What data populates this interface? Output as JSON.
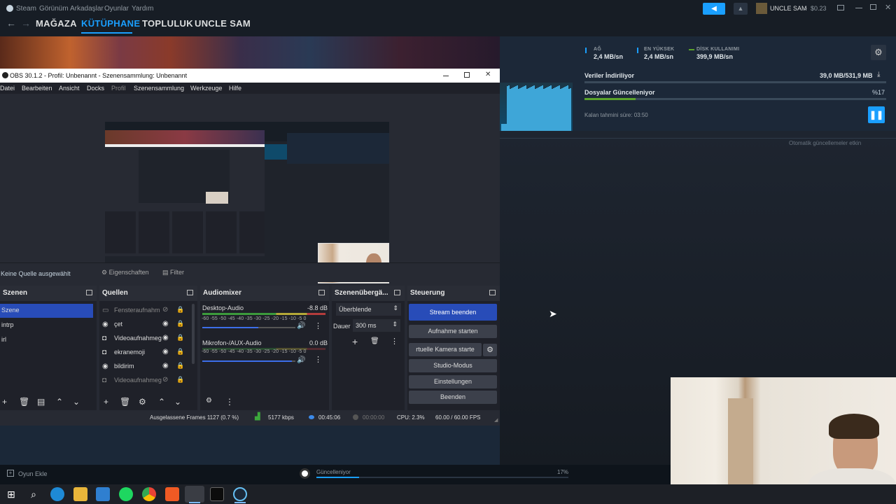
{
  "steam": {
    "menu": [
      "Steam",
      "Görünüm",
      "Arkadaşlar",
      "Oyunlar",
      "Yardım"
    ],
    "nav": [
      "MAĞAZA",
      "KÜTÜPHANE",
      "TOPLULUK",
      "UNCLE SAM"
    ],
    "user": {
      "name": "UNCLE SAM",
      "balance": "$0.23"
    },
    "stats": [
      {
        "label": "AĞ",
        "value": "2,4 MB/sn",
        "color": "#1a9fff"
      },
      {
        "label": "EN YÜKSEK",
        "value": "2,4 MB/sn",
        "color": "#1a9fff"
      },
      {
        "label": "DİSK KULLANIMI",
        "value": "399,9 MB/sn",
        "color": "#5ba32b"
      }
    ],
    "download": {
      "row1_label": "Veriler İndiriliyor",
      "row1_value": "39,0 MB/531,9 MB",
      "row2_label": "Dosyalar Güncelleniyor",
      "row2_value": "%17",
      "progress": 0.17,
      "eta": "Kalan tahmini süre: 03:50",
      "auto_updates": "Otomatik güncellemeler etkin"
    },
    "bottom": {
      "add_game": "Oyun Ekle",
      "status": "Güncelleniyor",
      "percent": "17%"
    }
  },
  "obs": {
    "title": "OBS 30.1.2 - Profil: Unbenannt - Szenensammlung: Unbenannt",
    "menu": [
      "Datei",
      "Bearbeiten",
      "Ansicht",
      "Docks",
      "Profil",
      "Szenensammlung",
      "Werkzeuge",
      "Hilfe"
    ],
    "no_source": "Keine Quelle ausgewählt",
    "properties": "Eigenschaften",
    "filter": "Filter",
    "docks": {
      "scenes": "Szenen",
      "sources": "Quellen",
      "mixer": "Audiomixer",
      "transitions": "Szenenübergä...",
      "controls": "Steuerung"
    },
    "scenes": [
      "Szene",
      "intrp",
      "irl"
    ],
    "sources": [
      {
        "name": "Fensteraufnahm",
        "icon": "window-icon"
      },
      {
        "name": "çet",
        "icon": "browser-icon"
      },
      {
        "name": "Videoaufnahmeg",
        "icon": "camera-icon"
      },
      {
        "name": "ekranemoji",
        "icon": "camera-icon"
      },
      {
        "name": "bildirim",
        "icon": "browser-icon"
      },
      {
        "name": "Videoaufnahmeg",
        "icon": "camera-icon"
      }
    ],
    "audio": [
      {
        "name": "Desktop-Audio",
        "db": "-8.8 dB",
        "level": 0.6
      },
      {
        "name": "Mikrofon-/AUX-Audio",
        "db": "0.0 dB",
        "level": 0.96
      }
    ],
    "meter_ticks": "-60 -55 -50 -45 -40 -35 -30 -25 -20 -15 -10 -5 0",
    "transition": {
      "type": "Überblende",
      "duration_label": "Dauer",
      "duration": "300 ms"
    },
    "controls": [
      "Stream beenden",
      "Aufnahme starten",
      "rtuelle Kamera starte",
      "Studio-Modus",
      "Einstellungen",
      "Beenden"
    ],
    "status": {
      "dropped": "Ausgelassene Frames 1127 (0.7 %)",
      "kbps": "5177 kbps",
      "stream_time": "00:45:06",
      "rec_time": "00:00:00",
      "cpu": "CPU: 2.3%",
      "fps": "60.00 / 60.00 FPS"
    }
  }
}
